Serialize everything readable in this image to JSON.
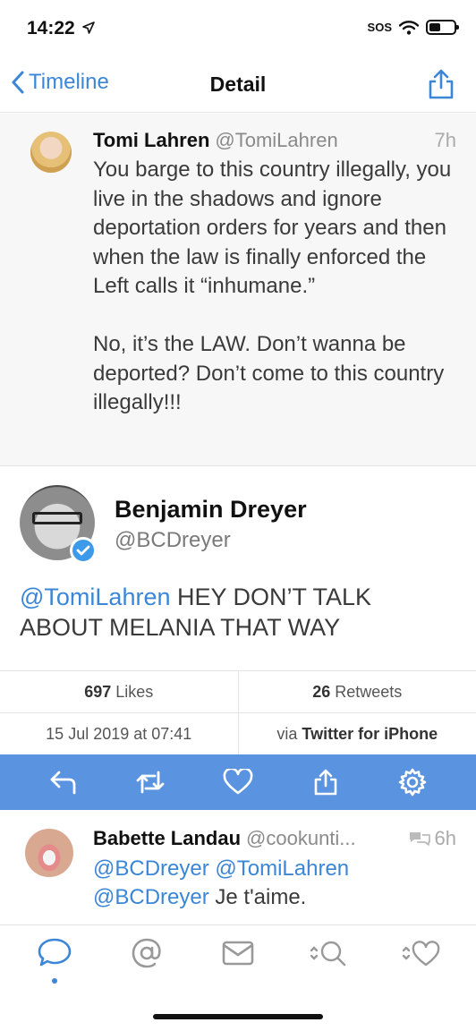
{
  "status": {
    "time": "14:22",
    "sos": "SOS"
  },
  "nav": {
    "back_label": "Timeline",
    "title": "Detail"
  },
  "parent_tweet": {
    "name": "Tomi Lahren",
    "handle": "@TomiLahren",
    "time": "7h",
    "body": "You barge to this country illegally, you live in the shadows and ignore deportation orders for years and then when the law is finally enforced the Left calls it “inhumane.”\n\nNo, it’s the LAW. Don’t wanna be deported? Don’t come to this country illegally!!!"
  },
  "main_tweet": {
    "name": "Benjamin Dreyer",
    "handle": "@BCDreyer",
    "mention": "@TomiLahren",
    "body": " HEY DON’T TALK ABOUT MELANIA THAT WAY"
  },
  "stats": {
    "likes_count": "697",
    "likes_label": "Likes",
    "retweets_count": "26",
    "retweets_label": "Retweets",
    "date": "15 Jul 2019 at 07:41",
    "via_label": "via",
    "client": "Twitter for iPhone"
  },
  "actions": [
    {
      "icon": "reply-icon"
    },
    {
      "icon": "retweet-icon"
    },
    {
      "icon": "heart-icon"
    },
    {
      "icon": "share-icon"
    },
    {
      "icon": "gear-icon"
    }
  ],
  "reply": {
    "name": "Babette Landau",
    "handle": "@cookunti...",
    "time": "6h",
    "mention1": "@BCDreyer",
    "mention2": "@TomiLahren",
    "mention3": "@BCDreyer",
    "text": " Je t'aime."
  },
  "tabs": [
    {
      "icon": "speech-bubble-icon",
      "active": true
    },
    {
      "icon": "at-icon"
    },
    {
      "icon": "mail-icon"
    },
    {
      "icon": "search-icon"
    },
    {
      "icon": "heart-icon"
    }
  ],
  "colors": {
    "accent": "#3b86d6",
    "action_bar": "#5a93e0"
  }
}
